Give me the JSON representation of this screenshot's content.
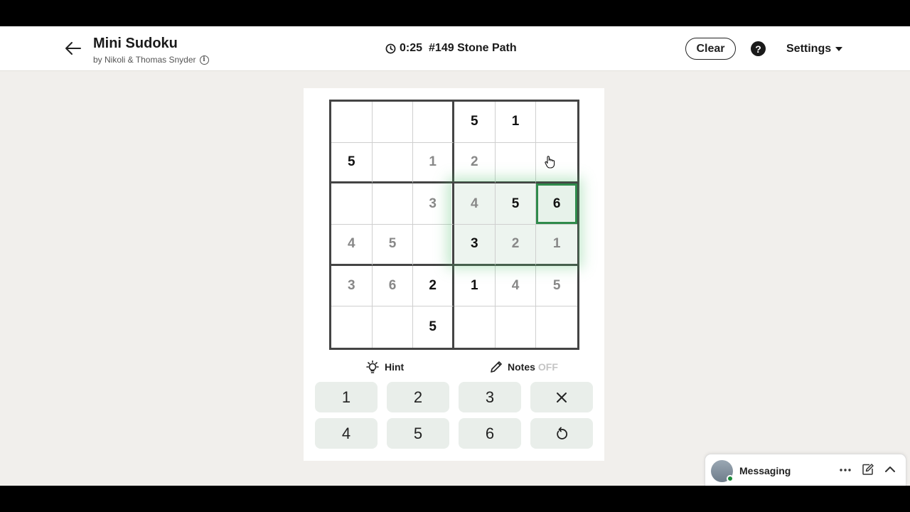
{
  "header": {
    "title": "Mini Sudoku",
    "byline": "by Nikoli & Thomas Snyder",
    "timer": "0:25",
    "puzzle_id": "#149 Stone Path",
    "clear_label": "Clear",
    "help_label": "?",
    "settings_label": "Settings"
  },
  "grid": {
    "rows": [
      [
        {
          "v": "",
          "t": "empty"
        },
        {
          "v": "",
          "t": "empty"
        },
        {
          "v": "",
          "t": "empty"
        },
        {
          "v": "5",
          "t": "given"
        },
        {
          "v": "1",
          "t": "given"
        },
        {
          "v": "",
          "t": "empty"
        }
      ],
      [
        {
          "v": "5",
          "t": "given"
        },
        {
          "v": "",
          "t": "empty"
        },
        {
          "v": "1",
          "t": "entered"
        },
        {
          "v": "2",
          "t": "entered"
        },
        {
          "v": "",
          "t": "empty"
        },
        {
          "v": "",
          "t": "empty"
        }
      ],
      [
        {
          "v": "",
          "t": "empty"
        },
        {
          "v": "",
          "t": "empty"
        },
        {
          "v": "3",
          "t": "entered"
        },
        {
          "v": "4",
          "t": "entered"
        },
        {
          "v": "5",
          "t": "given"
        },
        {
          "v": "6",
          "t": "given"
        }
      ],
      [
        {
          "v": "4",
          "t": "entered"
        },
        {
          "v": "5",
          "t": "entered"
        },
        {
          "v": "",
          "t": "empty"
        },
        {
          "v": "3",
          "t": "given"
        },
        {
          "v": "2",
          "t": "entered"
        },
        {
          "v": "1",
          "t": "entered"
        }
      ],
      [
        {
          "v": "3",
          "t": "entered"
        },
        {
          "v": "6",
          "t": "entered"
        },
        {
          "v": "2",
          "t": "given"
        },
        {
          "v": "1",
          "t": "given"
        },
        {
          "v": "4",
          "t": "entered"
        },
        {
          "v": "5",
          "t": "entered"
        }
      ],
      [
        {
          "v": "",
          "t": "empty"
        },
        {
          "v": "",
          "t": "empty"
        },
        {
          "v": "5",
          "t": "given"
        },
        {
          "v": "",
          "t": "empty"
        },
        {
          "v": "",
          "t": "empty"
        },
        {
          "v": "",
          "t": "empty"
        }
      ]
    ],
    "selected": [
      2,
      5
    ],
    "highlighted_box": {
      "rows": [
        2,
        3
      ],
      "cols": [
        3,
        4,
        5
      ]
    }
  },
  "controls": {
    "hint_label": "Hint",
    "notes_label": "Notes",
    "notes_state": "OFF"
  },
  "keypad": {
    "keys": [
      "1",
      "2",
      "3",
      "erase",
      "4",
      "5",
      "6",
      "undo"
    ]
  },
  "messaging": {
    "label": "Messaging"
  },
  "colors": {
    "accent_green": "#2f8a4b",
    "highlight": "#edf4ef",
    "key_bg": "#e9eeea"
  }
}
